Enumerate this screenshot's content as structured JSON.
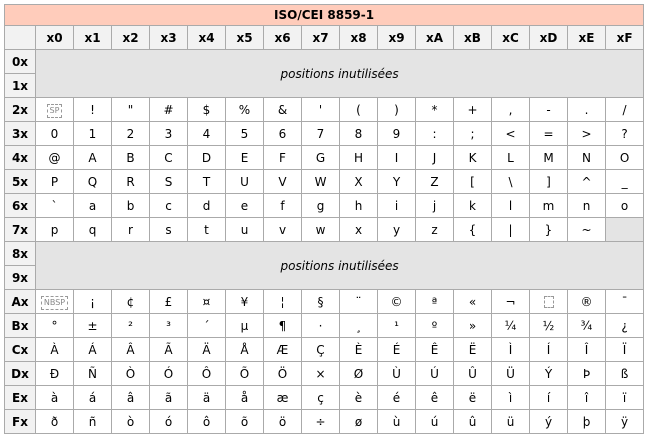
{
  "title": "ISO/CEI 8859-1",
  "columns": [
    "x0",
    "x1",
    "x2",
    "x3",
    "x4",
    "x5",
    "x6",
    "x7",
    "x8",
    "x9",
    "xA",
    "xB",
    "xC",
    "xD",
    "xE",
    "xF"
  ],
  "unused_label": "positions inutilisées",
  "block_unused_1": [
    "0x",
    "1x"
  ],
  "block_unused_2": [
    "8x",
    "9x"
  ],
  "rows_a": [
    {
      "label": "2x",
      "cells": [
        {
          "text": "SP",
          "control": true
        },
        {
          "text": "!"
        },
        {
          "text": "\""
        },
        {
          "text": "#"
        },
        {
          "text": "$"
        },
        {
          "text": "%"
        },
        {
          "text": "&"
        },
        {
          "text": "'"
        },
        {
          "text": "("
        },
        {
          "text": ")"
        },
        {
          "text": "*"
        },
        {
          "text": "+"
        },
        {
          "text": ","
        },
        {
          "text": "-"
        },
        {
          "text": "."
        },
        {
          "text": "/"
        }
      ]
    },
    {
      "label": "3x",
      "cells": [
        {
          "text": "0"
        },
        {
          "text": "1"
        },
        {
          "text": "2"
        },
        {
          "text": "3"
        },
        {
          "text": "4"
        },
        {
          "text": "5"
        },
        {
          "text": "6"
        },
        {
          "text": "7"
        },
        {
          "text": "8"
        },
        {
          "text": "9"
        },
        {
          "text": ":"
        },
        {
          "text": ";"
        },
        {
          "text": "<"
        },
        {
          "text": "="
        },
        {
          "text": ">"
        },
        {
          "text": "?"
        }
      ]
    },
    {
      "label": "4x",
      "cells": [
        {
          "text": "@"
        },
        {
          "text": "A"
        },
        {
          "text": "B"
        },
        {
          "text": "C"
        },
        {
          "text": "D"
        },
        {
          "text": "E"
        },
        {
          "text": "F"
        },
        {
          "text": "G"
        },
        {
          "text": "H"
        },
        {
          "text": "I"
        },
        {
          "text": "J"
        },
        {
          "text": "K"
        },
        {
          "text": "L"
        },
        {
          "text": "M"
        },
        {
          "text": "N"
        },
        {
          "text": "O"
        }
      ]
    },
    {
      "label": "5x",
      "cells": [
        {
          "text": "P"
        },
        {
          "text": "Q"
        },
        {
          "text": "R"
        },
        {
          "text": "S"
        },
        {
          "text": "T"
        },
        {
          "text": "U"
        },
        {
          "text": "V"
        },
        {
          "text": "W"
        },
        {
          "text": "X"
        },
        {
          "text": "Y"
        },
        {
          "text": "Z"
        },
        {
          "text": "["
        },
        {
          "text": "\\"
        },
        {
          "text": "]"
        },
        {
          "text": "^"
        },
        {
          "text": "_"
        }
      ]
    },
    {
      "label": "6x",
      "cells": [
        {
          "text": "`"
        },
        {
          "text": "a"
        },
        {
          "text": "b"
        },
        {
          "text": "c"
        },
        {
          "text": "d"
        },
        {
          "text": "e"
        },
        {
          "text": "f"
        },
        {
          "text": "g"
        },
        {
          "text": "h"
        },
        {
          "text": "i"
        },
        {
          "text": "j"
        },
        {
          "text": "k"
        },
        {
          "text": "l"
        },
        {
          "text": "m"
        },
        {
          "text": "n"
        },
        {
          "text": "o"
        }
      ]
    },
    {
      "label": "7x",
      "cells": [
        {
          "text": "p"
        },
        {
          "text": "q"
        },
        {
          "text": "r"
        },
        {
          "text": "s"
        },
        {
          "text": "t"
        },
        {
          "text": "u"
        },
        {
          "text": "v"
        },
        {
          "text": "w"
        },
        {
          "text": "x"
        },
        {
          "text": "y"
        },
        {
          "text": "z"
        },
        {
          "text": "{"
        },
        {
          "text": "|"
        },
        {
          "text": "}"
        },
        {
          "text": "~"
        },
        {
          "text": "",
          "empty": true
        }
      ]
    }
  ],
  "rows_b": [
    {
      "label": "Ax",
      "cells": [
        {
          "text": "NBSP",
          "control": true
        },
        {
          "text": "¡"
        },
        {
          "text": "¢"
        },
        {
          "text": "£"
        },
        {
          "text": "¤"
        },
        {
          "text": "¥"
        },
        {
          "text": "¦"
        },
        {
          "text": "§"
        },
        {
          "text": "¨"
        },
        {
          "text": "©"
        },
        {
          "text": "ª"
        },
        {
          "text": "«"
        },
        {
          "text": "¬"
        },
        {
          "text": "",
          "blank_control": true
        },
        {
          "text": "®"
        },
        {
          "text": "¯"
        }
      ]
    },
    {
      "label": "Bx",
      "cells": [
        {
          "text": "°"
        },
        {
          "text": "±"
        },
        {
          "text": "²"
        },
        {
          "text": "³"
        },
        {
          "text": "´"
        },
        {
          "text": "µ"
        },
        {
          "text": "¶"
        },
        {
          "text": "·"
        },
        {
          "text": "¸"
        },
        {
          "text": "¹"
        },
        {
          "text": "º"
        },
        {
          "text": "»"
        },
        {
          "text": "¼"
        },
        {
          "text": "½"
        },
        {
          "text": "¾"
        },
        {
          "text": "¿"
        }
      ]
    },
    {
      "label": "Cx",
      "cells": [
        {
          "text": "À"
        },
        {
          "text": "Á"
        },
        {
          "text": "Â"
        },
        {
          "text": "Ã"
        },
        {
          "text": "Ä"
        },
        {
          "text": "Å"
        },
        {
          "text": "Æ"
        },
        {
          "text": "Ç"
        },
        {
          "text": "È"
        },
        {
          "text": "É"
        },
        {
          "text": "Ê"
        },
        {
          "text": "Ë"
        },
        {
          "text": "Ì"
        },
        {
          "text": "Í"
        },
        {
          "text": "Î"
        },
        {
          "text": "Ï"
        }
      ]
    },
    {
      "label": "Dx",
      "cells": [
        {
          "text": "Ð"
        },
        {
          "text": "Ñ"
        },
        {
          "text": "Ò"
        },
        {
          "text": "Ó"
        },
        {
          "text": "Ô"
        },
        {
          "text": "Õ"
        },
        {
          "text": "Ö"
        },
        {
          "text": "×"
        },
        {
          "text": "Ø"
        },
        {
          "text": "Ù"
        },
        {
          "text": "Ú"
        },
        {
          "text": "Û"
        },
        {
          "text": "Ü"
        },
        {
          "text": "Ý"
        },
        {
          "text": "Þ"
        },
        {
          "text": "ß"
        }
      ]
    },
    {
      "label": "Ex",
      "cells": [
        {
          "text": "à"
        },
        {
          "text": "á"
        },
        {
          "text": "â"
        },
        {
          "text": "ã"
        },
        {
          "text": "ä"
        },
        {
          "text": "å"
        },
        {
          "text": "æ"
        },
        {
          "text": "ç"
        },
        {
          "text": "è"
        },
        {
          "text": "é"
        },
        {
          "text": "ê"
        },
        {
          "text": "ë"
        },
        {
          "text": "ì"
        },
        {
          "text": "í"
        },
        {
          "text": "î"
        },
        {
          "text": "ï"
        }
      ]
    },
    {
      "label": "Fx",
      "cells": [
        {
          "text": "ð"
        },
        {
          "text": "ñ"
        },
        {
          "text": "ò"
        },
        {
          "text": "ó"
        },
        {
          "text": "ô"
        },
        {
          "text": "õ"
        },
        {
          "text": "ö"
        },
        {
          "text": "÷"
        },
        {
          "text": "ø"
        },
        {
          "text": "ù"
        },
        {
          "text": "ú"
        },
        {
          "text": "û"
        },
        {
          "text": "ü"
        },
        {
          "text": "ý"
        },
        {
          "text": "þ"
        },
        {
          "text": "ÿ"
        }
      ]
    }
  ]
}
